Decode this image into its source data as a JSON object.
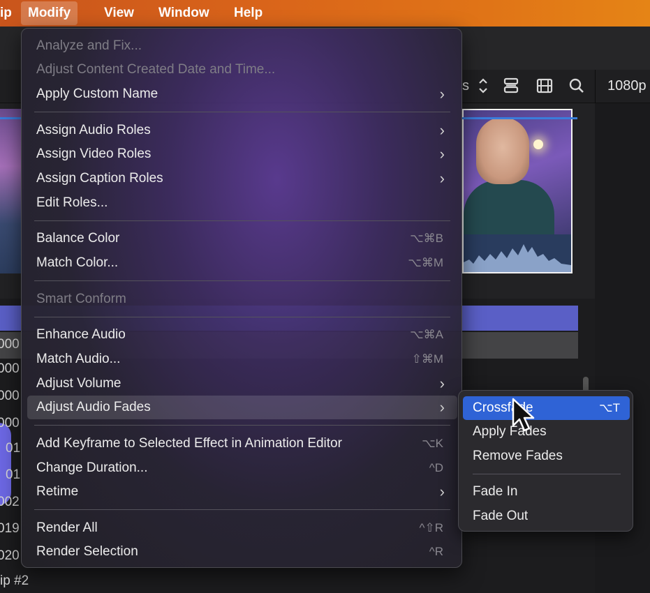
{
  "menubar": {
    "partial_left": "ip",
    "items": [
      "Modify",
      "View",
      "Window",
      "Help"
    ],
    "active": "Modify"
  },
  "toolbar": {
    "partial_text": "s",
    "resolution": "1080p",
    "icons": [
      "stepper-icon",
      "track-layout-icon",
      "filmstrip-icon",
      "search-icon"
    ]
  },
  "timeline": {
    "row_labels": [
      "000",
      "000",
      "000",
      "000",
      "01",
      "01",
      "002",
      "019",
      "020"
    ],
    "clip_label": "ip #2"
  },
  "modify_menu": {
    "items": [
      {
        "label": "Analyze and Fix...",
        "enabled": false,
        "shortcut": "",
        "submenu": false
      },
      {
        "label": "Adjust Content Created Date and Time...",
        "enabled": false,
        "shortcut": "",
        "submenu": false
      },
      {
        "label": "Apply Custom Name",
        "enabled": true,
        "shortcut": "",
        "submenu": true
      },
      {
        "label": "Assign Audio Roles",
        "enabled": true,
        "shortcut": "",
        "submenu": true
      },
      {
        "label": "Assign Video Roles",
        "enabled": true,
        "shortcut": "",
        "submenu": true
      },
      {
        "label": "Assign Caption Roles",
        "enabled": true,
        "shortcut": "",
        "submenu": true
      },
      {
        "label": "Edit Roles...",
        "enabled": true,
        "shortcut": "",
        "submenu": false
      },
      {
        "label": "Balance Color",
        "enabled": true,
        "shortcut": "⌥⌘B",
        "submenu": false
      },
      {
        "label": "Match Color...",
        "enabled": true,
        "shortcut": "⌥⌘M",
        "submenu": false
      },
      {
        "label": "Smart Conform",
        "enabled": false,
        "shortcut": "",
        "submenu": false
      },
      {
        "label": "Enhance Audio",
        "enabled": true,
        "shortcut": "⌥⌘A",
        "submenu": false
      },
      {
        "label": "Match Audio...",
        "enabled": true,
        "shortcut": "⇧⌘M",
        "submenu": false
      },
      {
        "label": "Adjust Volume",
        "enabled": true,
        "shortcut": "",
        "submenu": true
      },
      {
        "label": "Adjust Audio Fades",
        "enabled": true,
        "shortcut": "",
        "submenu": true,
        "highlighted": true
      },
      {
        "label": "Add Keyframe to Selected Effect in Animation Editor",
        "enabled": true,
        "shortcut": "⌥K",
        "submenu": false
      },
      {
        "label": "Change Duration...",
        "enabled": true,
        "shortcut": "^D",
        "submenu": false
      },
      {
        "label": "Retime",
        "enabled": true,
        "shortcut": "",
        "submenu": true
      },
      {
        "label": "Render All",
        "enabled": true,
        "shortcut": "^⇧R",
        "submenu": false
      },
      {
        "label": "Render Selection",
        "enabled": true,
        "shortcut": "^R",
        "submenu": false
      }
    ],
    "chevron": "›"
  },
  "fades_submenu": {
    "items": [
      {
        "label": "Crossfade",
        "shortcut": "⌥T",
        "selected": true
      },
      {
        "label": "Apply Fades",
        "shortcut": "",
        "selected": false
      },
      {
        "label": "Remove Fades",
        "shortcut": "",
        "selected": false
      },
      {
        "label": "Fade In",
        "shortcut": "",
        "selected": false
      },
      {
        "label": "Fade Out",
        "shortcut": "",
        "selected": false
      }
    ]
  },
  "colors": {
    "menubar_accent": "#d9641a",
    "selection_blue": "#2f63d6",
    "track_purple": "#5a5fc6"
  }
}
